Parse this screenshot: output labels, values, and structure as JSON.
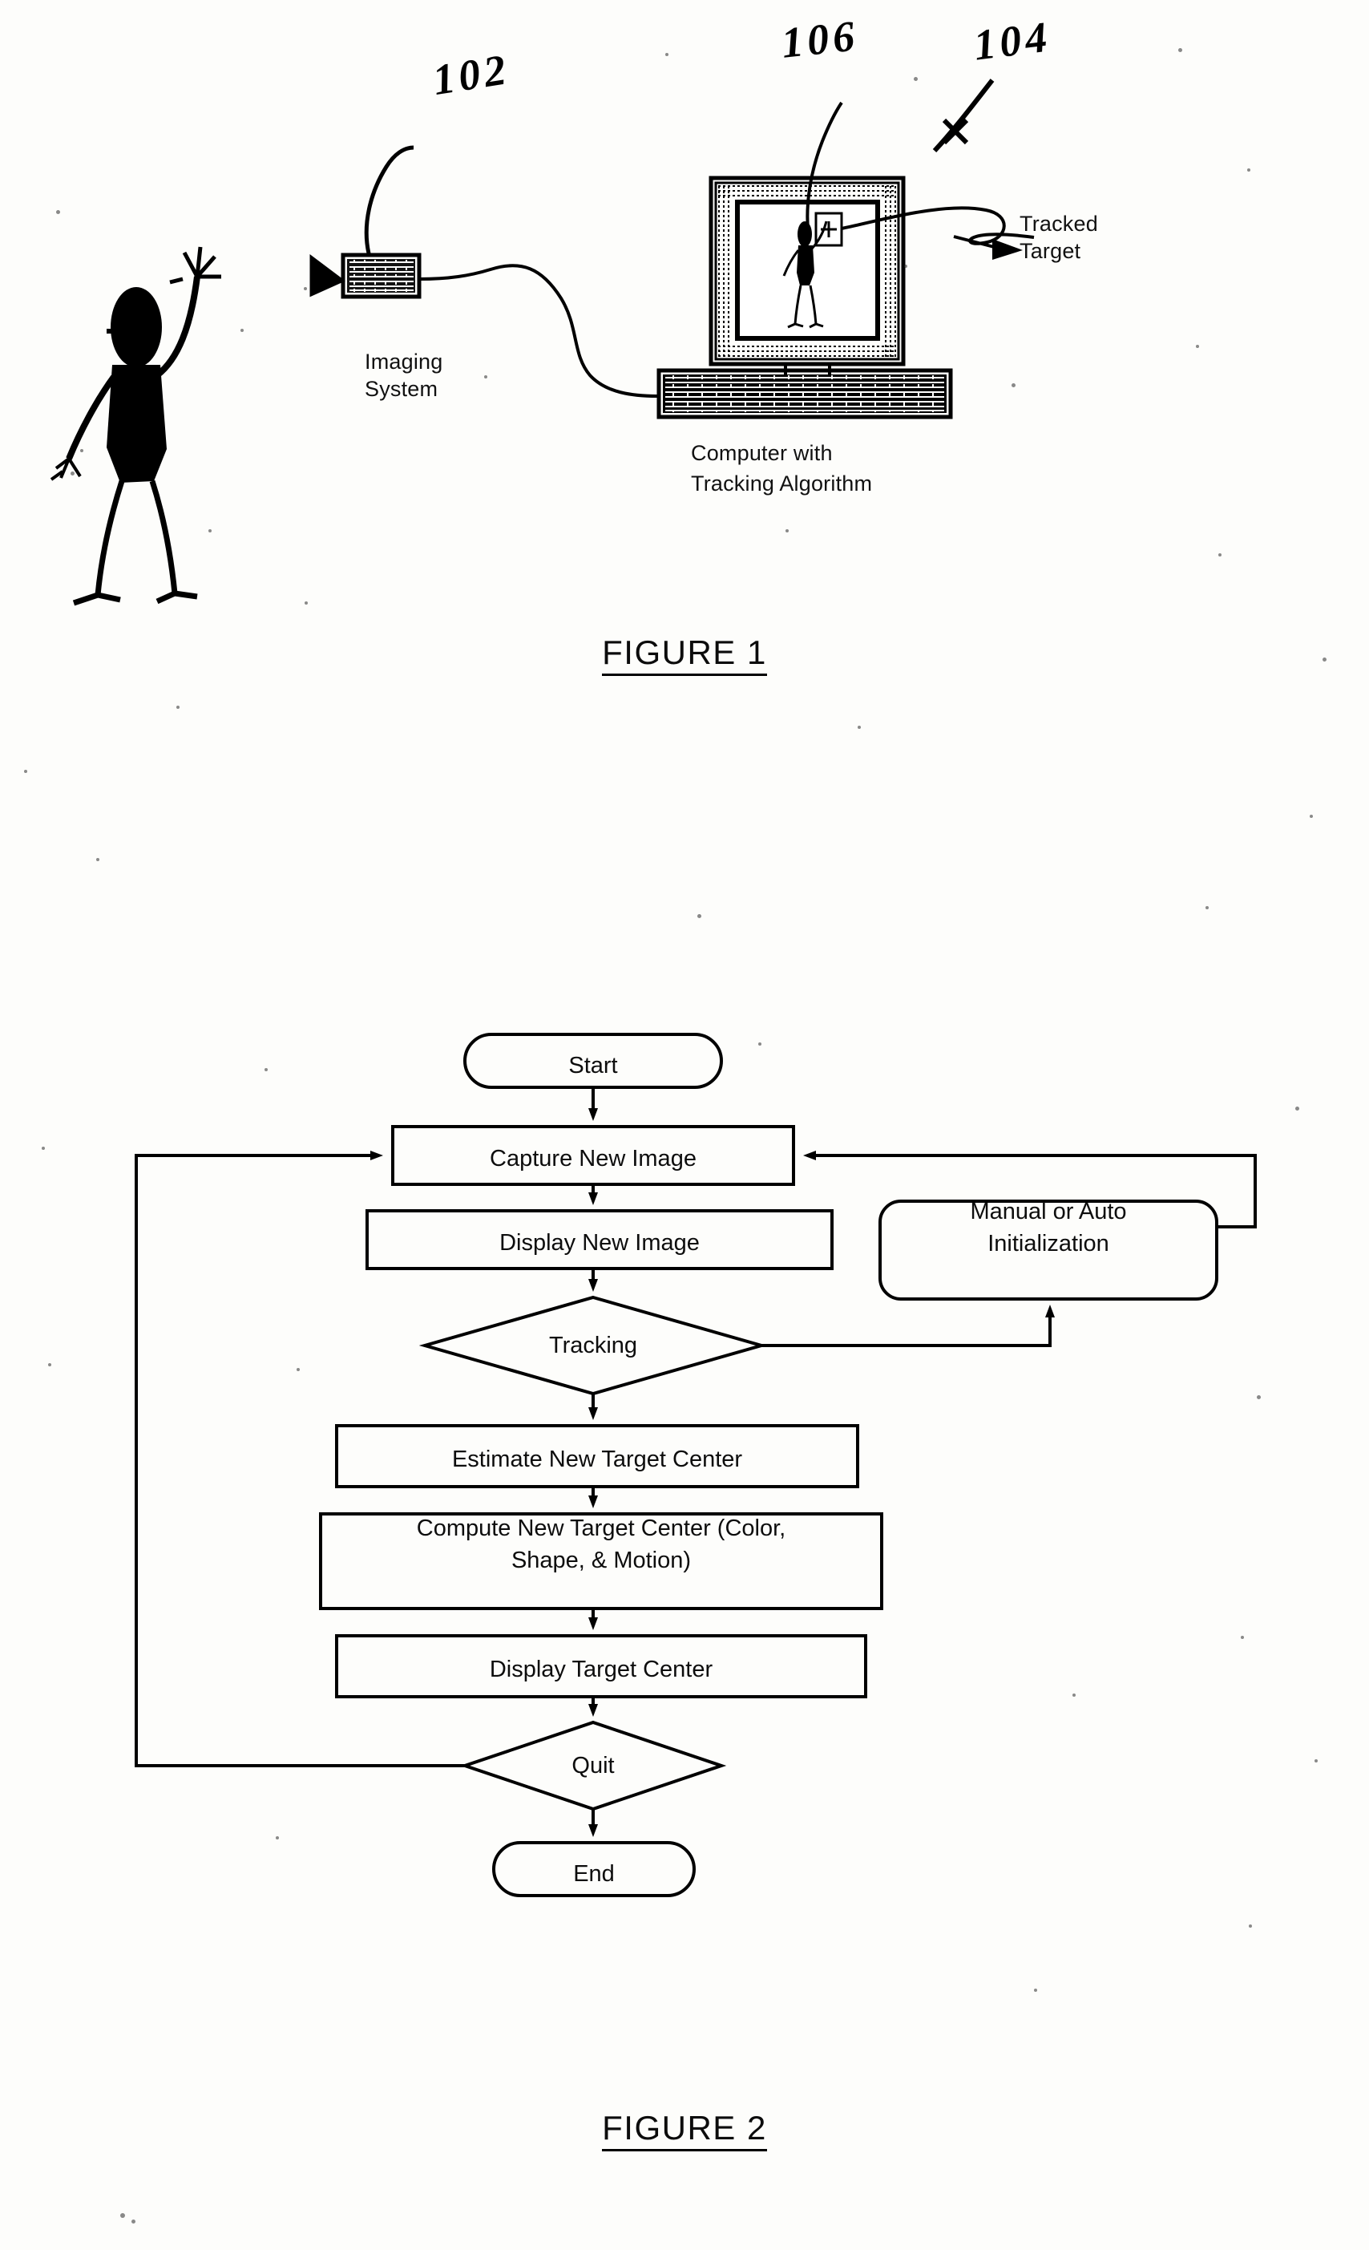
{
  "document": {
    "type": "patent-drawing-sheet",
    "figures": [
      "FIGURE 1",
      "FIGURE 2"
    ]
  },
  "figure1": {
    "caption": "FIGURE 1",
    "reference_numerals": [
      {
        "id": "102",
        "text": "102",
        "points_to": "imaging-system-camera"
      },
      {
        "id": "106",
        "text": "106",
        "points_to": "monitor-screen"
      },
      {
        "id": "104",
        "text": "104",
        "points_to": "computer-monitor"
      }
    ],
    "labels": {
      "imaging_system": "Imaging\nSystem",
      "imaging_system_line1": "Imaging",
      "imaging_system_line2": "System",
      "tracked_target": "Tracked\nTarget",
      "tracked_target_line1": "Tracked",
      "tracked_target_line2": "Target",
      "computer": "Computer with\nTracking Algorithm",
      "computer_line1": "Computer with",
      "computer_line2": "Tracking Algorithm"
    },
    "elements": {
      "person": "stick-figure-person-waving",
      "camera": "video-camera",
      "monitor": "crt-monitor",
      "computer_base": "computer-chassis",
      "cable": "cable-from-camera-to-computer",
      "target_box": "tracking-bounding-box-on-screen"
    }
  },
  "figure2": {
    "caption": "FIGURE 2",
    "chart_data": {
      "type": "diagram",
      "title": "FIGURE 2",
      "nodes": [
        {
          "id": "start",
          "shape": "terminator",
          "label": "Start"
        },
        {
          "id": "capture",
          "shape": "process",
          "label": "Capture New Image"
        },
        {
          "id": "displaynew",
          "shape": "process",
          "label": "Display New Image"
        },
        {
          "id": "tracking",
          "shape": "decision",
          "label": "Tracking"
        },
        {
          "id": "init",
          "shape": "rounded",
          "label": "Manual or Auto Initialization"
        },
        {
          "id": "estimate",
          "shape": "process",
          "label": "Estimate New Target Center"
        },
        {
          "id": "compute",
          "shape": "process",
          "label": "Compute New Target Center (Color, Shape, & Motion)"
        },
        {
          "id": "displaytc",
          "shape": "process",
          "label": "Display Target Center"
        },
        {
          "id": "quit",
          "shape": "decision",
          "label": "Quit"
        },
        {
          "id": "end",
          "shape": "terminator",
          "label": "End"
        }
      ],
      "edges": [
        {
          "from": "start",
          "to": "capture"
        },
        {
          "from": "capture",
          "to": "displaynew"
        },
        {
          "from": "displaynew",
          "to": "tracking"
        },
        {
          "from": "tracking",
          "to": "init",
          "route": "right"
        },
        {
          "from": "init",
          "to": "capture",
          "route": "right-up"
        },
        {
          "from": "tracking",
          "to": "estimate"
        },
        {
          "from": "estimate",
          "to": "compute"
        },
        {
          "from": "compute",
          "to": "displaytc"
        },
        {
          "from": "displaytc",
          "to": "quit"
        },
        {
          "from": "quit",
          "to": "end"
        },
        {
          "from": "quit",
          "to": "capture",
          "route": "left-loop"
        }
      ]
    },
    "nodes": {
      "start": "Start",
      "capture_new_image": "Capture New Image",
      "display_new_image": "Display New Image",
      "tracking": "Tracking",
      "manual_or_auto_initialization_line1": "Manual or Auto",
      "manual_or_auto_initialization_line2": "Initialization",
      "estimate_new_target_center": "Estimate New Target Center",
      "compute_new_target_center_line1": "Compute New Target Center (Color,",
      "compute_new_target_center_line2": "Shape, & Motion)",
      "display_target_center": "Display Target Center",
      "quit": "Quit",
      "end": "End"
    }
  },
  "colors": {
    "ink": "#000000",
    "paper": "#fdfdfb"
  }
}
